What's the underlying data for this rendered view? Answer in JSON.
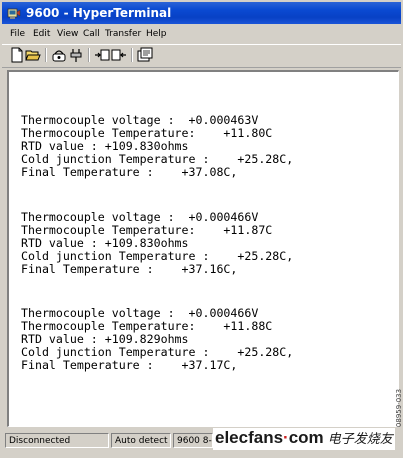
{
  "window": {
    "title": "9600 - HyperTerminal"
  },
  "menu": {
    "items": [
      "File",
      "Edit",
      "View",
      "Call",
      "Transfer",
      "Help"
    ]
  },
  "toolbar": {
    "icons": [
      "new-icon",
      "open-icon",
      "connect-icon",
      "disconnect-icon",
      "send-icon",
      "receive-icon",
      "properties-icon"
    ]
  },
  "terminal": {
    "lines": [
      "Thermocouple voltage :  +0.000463V",
      "Thermocouple Temperature:    +11.80C",
      "RTD value : +109.830ohms",
      "Cold junction Temperature :    +25.28C,",
      "Final Temperature :    +37.08C,",
      "",
      "Thermocouple voltage :  +0.000466V",
      "Thermocouple Temperature:    +11.87C",
      "RTD value : +109.830ohms",
      "Cold junction Temperature :    +25.28C,",
      "Final Temperature :    +37.16C,",
      "",
      "Thermocouple voltage :  +0.000466V",
      "Thermocouple Temperature:    +11.88C",
      "RTD value : +109.829ohms",
      "Cold junction Temperature :    +25.28C,",
      "Final Temperature :    +37.17C,"
    ]
  },
  "status": {
    "connection": "Disconnected",
    "detect": "Auto detect",
    "settings": "9600 8-N-1"
  },
  "watermark": {
    "brand_left": "elecfans",
    "brand_dot": "·",
    "brand_right": "com",
    "chinese": "电子发烧友"
  },
  "side_code": "08959-033"
}
